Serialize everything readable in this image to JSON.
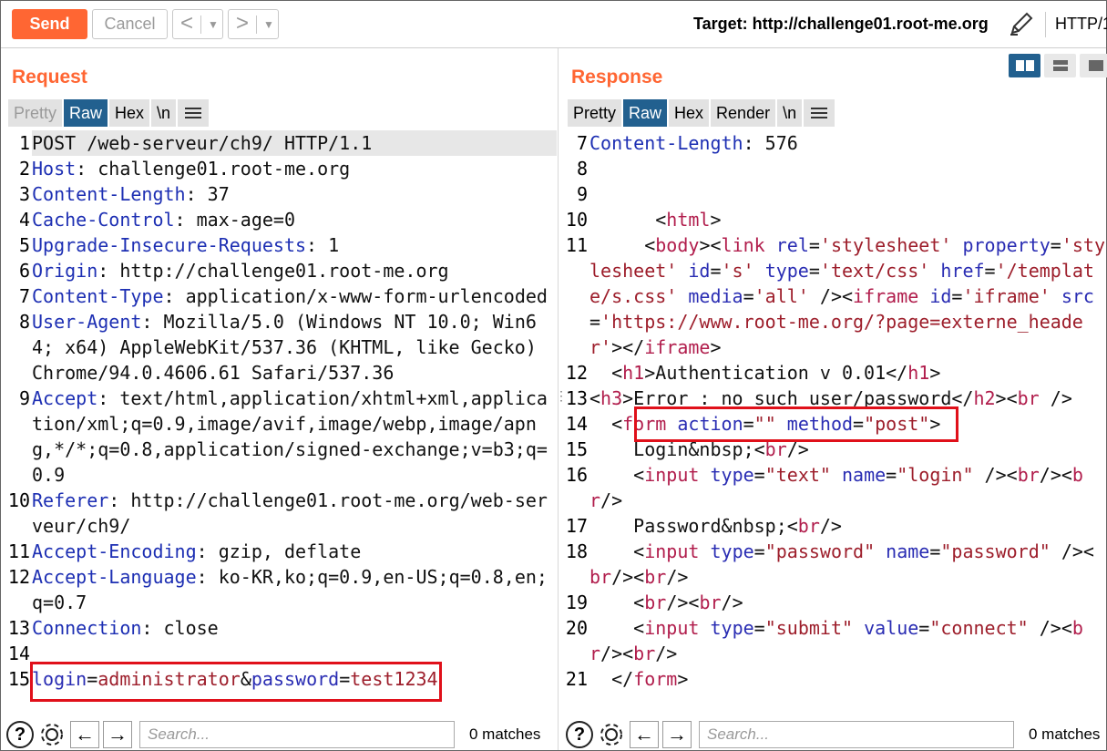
{
  "toolbar": {
    "send_label": "Send",
    "cancel_label": "Cancel",
    "back_arrow": "<",
    "forward_arrow": ">",
    "dropdown_glyph": "▼",
    "target_label": "Target: http://challenge01.root-me.org",
    "edit_icon": "pencil-icon",
    "protocol_label": "HTTP/1"
  },
  "request": {
    "title": "Request",
    "tabs": [
      {
        "label": "Pretty"
      },
      {
        "label": "Raw"
      },
      {
        "label": "Hex"
      },
      {
        "label": "\\n"
      }
    ],
    "lines": [
      {
        "n": "1",
        "parts": [
          {
            "c": "v",
            "t": "POST /web-serveur/ch9/ HTTP/1.1"
          }
        ]
      },
      {
        "n": "2",
        "parts": [
          {
            "c": "k",
            "t": "Host"
          },
          {
            "c": "v",
            "t": ": challenge01.root-me.org"
          }
        ]
      },
      {
        "n": "3",
        "parts": [
          {
            "c": "k",
            "t": "Content-Length"
          },
          {
            "c": "v",
            "t": ": 37"
          }
        ]
      },
      {
        "n": "4",
        "parts": [
          {
            "c": "k",
            "t": "Cache-Control"
          },
          {
            "c": "v",
            "t": ": max-age=0"
          }
        ]
      },
      {
        "n": "5",
        "parts": [
          {
            "c": "k",
            "t": "Upgrade-Insecure-Requests"
          },
          {
            "c": "v",
            "t": ": 1"
          }
        ]
      },
      {
        "n": "6",
        "parts": [
          {
            "c": "k",
            "t": "Origin"
          },
          {
            "c": "v",
            "t": ": http://challenge01.root-me.org"
          }
        ]
      },
      {
        "n": "7",
        "parts": [
          {
            "c": "k",
            "t": "Content-Type"
          },
          {
            "c": "v",
            "t": ": application/x-www-form-urlencoded"
          }
        ]
      },
      {
        "n": "8",
        "parts": [
          {
            "c": "k",
            "t": "User-Agent"
          },
          {
            "c": "v",
            "t": ": Mozilla/5.0 (Windows NT 10.0; Win64; x64) AppleWebKit/537.36 (KHTML, like Gecko) Chrome/94.0.4606.61 Safari/537.36"
          }
        ]
      },
      {
        "n": "9",
        "parts": [
          {
            "c": "k",
            "t": "Accept"
          },
          {
            "c": "v",
            "t": ": text/html,application/xhtml+xml,application/xml;q=0.9,image/avif,image/webp,image/apng,*/*;q=0.8,application/signed-exchange;v=b3;q=0.9"
          }
        ]
      },
      {
        "n": "10",
        "parts": [
          {
            "c": "k",
            "t": "Referer"
          },
          {
            "c": "v",
            "t": ": http://challenge01.root-me.org/web-serveur/ch9/"
          }
        ]
      },
      {
        "n": "11",
        "parts": [
          {
            "c": "k",
            "t": "Accept-Encoding"
          },
          {
            "c": "v",
            "t": ": gzip, deflate"
          }
        ]
      },
      {
        "n": "12",
        "parts": [
          {
            "c": "k",
            "t": "Accept-Language"
          },
          {
            "c": "v",
            "t": ": ko-KR,ko;q=0.9,en-US;q=0.8,en;q=0.7"
          }
        ]
      },
      {
        "n": "13",
        "parts": [
          {
            "c": "k",
            "t": "Connection"
          },
          {
            "c": "v",
            "t": ": close"
          }
        ]
      },
      {
        "n": "14",
        "parts": []
      },
      {
        "n": "15",
        "parts": [
          {
            "c": "a",
            "t": "login"
          },
          {
            "c": "v",
            "t": "="
          },
          {
            "c": "s",
            "t": "administrator"
          },
          {
            "c": "v",
            "t": "&"
          },
          {
            "c": "a",
            "t": "password"
          },
          {
            "c": "v",
            "t": "="
          },
          {
            "c": "s",
            "t": "test1234"
          }
        ]
      }
    ]
  },
  "response": {
    "title": "Response",
    "tabs": [
      {
        "label": "Pretty"
      },
      {
        "label": "Raw"
      },
      {
        "label": "Hex"
      },
      {
        "label": "Render"
      },
      {
        "label": "\\n"
      }
    ],
    "lines": [
      {
        "n": "7",
        "parts": [
          {
            "c": "k",
            "t": "Content-Length"
          },
          {
            "c": "v",
            "t": ": 576"
          }
        ]
      },
      {
        "n": "8",
        "parts": []
      },
      {
        "n": "9",
        "parts": []
      },
      {
        "n": "10",
        "parts": [
          {
            "c": "v",
            "t": "      <"
          },
          {
            "c": "t",
            "t": "html"
          },
          {
            "c": "v",
            "t": ">"
          }
        ]
      },
      {
        "n": "11",
        "parts": [
          {
            "c": "v",
            "t": "     <"
          },
          {
            "c": "t",
            "t": "body"
          },
          {
            "c": "v",
            "t": "><"
          },
          {
            "c": "t",
            "t": "link"
          },
          {
            "c": "v",
            "t": " "
          },
          {
            "c": "a",
            "t": "rel"
          },
          {
            "c": "v",
            "t": "="
          },
          {
            "c": "s",
            "t": "'stylesheet'"
          },
          {
            "c": "v",
            "t": " "
          },
          {
            "c": "a",
            "t": "property"
          },
          {
            "c": "v",
            "t": "="
          },
          {
            "c": "s",
            "t": "'stylesheet'"
          },
          {
            "c": "v",
            "t": " "
          },
          {
            "c": "a",
            "t": "id"
          },
          {
            "c": "v",
            "t": "="
          },
          {
            "c": "s",
            "t": "'s'"
          },
          {
            "c": "v",
            "t": " "
          },
          {
            "c": "a",
            "t": "type"
          },
          {
            "c": "v",
            "t": "="
          },
          {
            "c": "s",
            "t": "'text/css'"
          },
          {
            "c": "v",
            "t": " "
          },
          {
            "c": "a",
            "t": "href"
          },
          {
            "c": "v",
            "t": "="
          },
          {
            "c": "s",
            "t": "'/template/s.css'"
          },
          {
            "c": "v",
            "t": " "
          },
          {
            "c": "a",
            "t": "media"
          },
          {
            "c": "v",
            "t": "="
          },
          {
            "c": "s",
            "t": "'all'"
          },
          {
            "c": "v",
            "t": " /><"
          },
          {
            "c": "t",
            "t": "iframe"
          },
          {
            "c": "v",
            "t": " "
          },
          {
            "c": "a",
            "t": "id"
          },
          {
            "c": "v",
            "t": "="
          },
          {
            "c": "s",
            "t": "'iframe'"
          },
          {
            "c": "v",
            "t": " "
          },
          {
            "c": "a",
            "t": "src"
          },
          {
            "c": "v",
            "t": "="
          },
          {
            "c": "s",
            "t": "'https://www.root-me.org/?page=externe_header'"
          },
          {
            "c": "v",
            "t": "></"
          },
          {
            "c": "t",
            "t": "iframe"
          },
          {
            "c": "v",
            "t": ">"
          }
        ]
      },
      {
        "n": "12",
        "parts": [
          {
            "c": "v",
            "t": "  <"
          },
          {
            "c": "t",
            "t": "h1"
          },
          {
            "c": "v",
            "t": ">Authentication v 0.01</"
          },
          {
            "c": "t",
            "t": "h1"
          },
          {
            "c": "v",
            "t": ">"
          }
        ]
      },
      {
        "n": "13",
        "parts": [
          {
            "c": "v",
            "t": "<"
          },
          {
            "c": "t",
            "t": "h3"
          },
          {
            "c": "v",
            "t": ">Error : no such user/password</"
          },
          {
            "c": "t",
            "t": "h2"
          },
          {
            "c": "v",
            "t": "><"
          },
          {
            "c": "t",
            "t": "br"
          },
          {
            "c": "v",
            "t": " />"
          }
        ]
      },
      {
        "n": "14",
        "parts": [
          {
            "c": "v",
            "t": "  <"
          },
          {
            "c": "t",
            "t": "form"
          },
          {
            "c": "v",
            "t": " "
          },
          {
            "c": "a",
            "t": "action"
          },
          {
            "c": "v",
            "t": "="
          },
          {
            "c": "s",
            "t": "\"\""
          },
          {
            "c": "v",
            "t": " "
          },
          {
            "c": "a",
            "t": "method"
          },
          {
            "c": "v",
            "t": "="
          },
          {
            "c": "s",
            "t": "\"post\""
          },
          {
            "c": "v",
            "t": ">"
          }
        ]
      },
      {
        "n": "15",
        "parts": [
          {
            "c": "v",
            "t": "    Login&nbsp;<"
          },
          {
            "c": "t",
            "t": "br"
          },
          {
            "c": "v",
            "t": "/>"
          }
        ]
      },
      {
        "n": "16",
        "parts": [
          {
            "c": "v",
            "t": "    <"
          },
          {
            "c": "t",
            "t": "input"
          },
          {
            "c": "v",
            "t": " "
          },
          {
            "c": "a",
            "t": "type"
          },
          {
            "c": "v",
            "t": "="
          },
          {
            "c": "s",
            "t": "\"text\""
          },
          {
            "c": "v",
            "t": " "
          },
          {
            "c": "a",
            "t": "name"
          },
          {
            "c": "v",
            "t": "="
          },
          {
            "c": "s",
            "t": "\"login\""
          },
          {
            "c": "v",
            "t": " /><"
          },
          {
            "c": "t",
            "t": "br"
          },
          {
            "c": "v",
            "t": "/><"
          },
          {
            "c": "t",
            "t": "br"
          },
          {
            "c": "v",
            "t": "/>"
          }
        ]
      },
      {
        "n": "17",
        "parts": [
          {
            "c": "v",
            "t": "    Password&nbsp;<"
          },
          {
            "c": "t",
            "t": "br"
          },
          {
            "c": "v",
            "t": "/>"
          }
        ]
      },
      {
        "n": "18",
        "parts": [
          {
            "c": "v",
            "t": "    <"
          },
          {
            "c": "t",
            "t": "input"
          },
          {
            "c": "v",
            "t": " "
          },
          {
            "c": "a",
            "t": "type"
          },
          {
            "c": "v",
            "t": "="
          },
          {
            "c": "s",
            "t": "\"password\""
          },
          {
            "c": "v",
            "t": " "
          },
          {
            "c": "a",
            "t": "name"
          },
          {
            "c": "v",
            "t": "="
          },
          {
            "c": "s",
            "t": "\"password\""
          },
          {
            "c": "v",
            "t": " /><"
          },
          {
            "c": "t",
            "t": "br"
          },
          {
            "c": "v",
            "t": "/><"
          },
          {
            "c": "t",
            "t": "br"
          },
          {
            "c": "v",
            "t": "/>"
          }
        ]
      },
      {
        "n": "19",
        "parts": [
          {
            "c": "v",
            "t": "    <"
          },
          {
            "c": "t",
            "t": "br"
          },
          {
            "c": "v",
            "t": "/><"
          },
          {
            "c": "t",
            "t": "br"
          },
          {
            "c": "v",
            "t": "/>"
          }
        ]
      },
      {
        "n": "20",
        "parts": [
          {
            "c": "v",
            "t": "    <"
          },
          {
            "c": "t",
            "t": "input"
          },
          {
            "c": "v",
            "t": " "
          },
          {
            "c": "a",
            "t": "type"
          },
          {
            "c": "v",
            "t": "="
          },
          {
            "c": "s",
            "t": "\"submit\""
          },
          {
            "c": "v",
            "t": " "
          },
          {
            "c": "a",
            "t": "value"
          },
          {
            "c": "v",
            "t": "="
          },
          {
            "c": "s",
            "t": "\"connect\""
          },
          {
            "c": "v",
            "t": " /><"
          },
          {
            "c": "t",
            "t": "br"
          },
          {
            "c": "v",
            "t": "/><"
          },
          {
            "c": "t",
            "t": "br"
          },
          {
            "c": "v",
            "t": "/>"
          }
        ]
      },
      {
        "n": "21",
        "parts": [
          {
            "c": "v",
            "t": "  </"
          },
          {
            "c": "t",
            "t": "form"
          },
          {
            "c": "v",
            "t": ">"
          }
        ]
      }
    ]
  },
  "bottom": {
    "help_glyph": "?",
    "settings_icon": "gear-icon",
    "prev_glyph": "←",
    "next_glyph": "→",
    "search_placeholder": "Search...",
    "matches_label": "0 matches"
  },
  "colors": {
    "accent": "#ff6633",
    "tab_active": "#22608f",
    "highlight_box": "#e0101a"
  }
}
